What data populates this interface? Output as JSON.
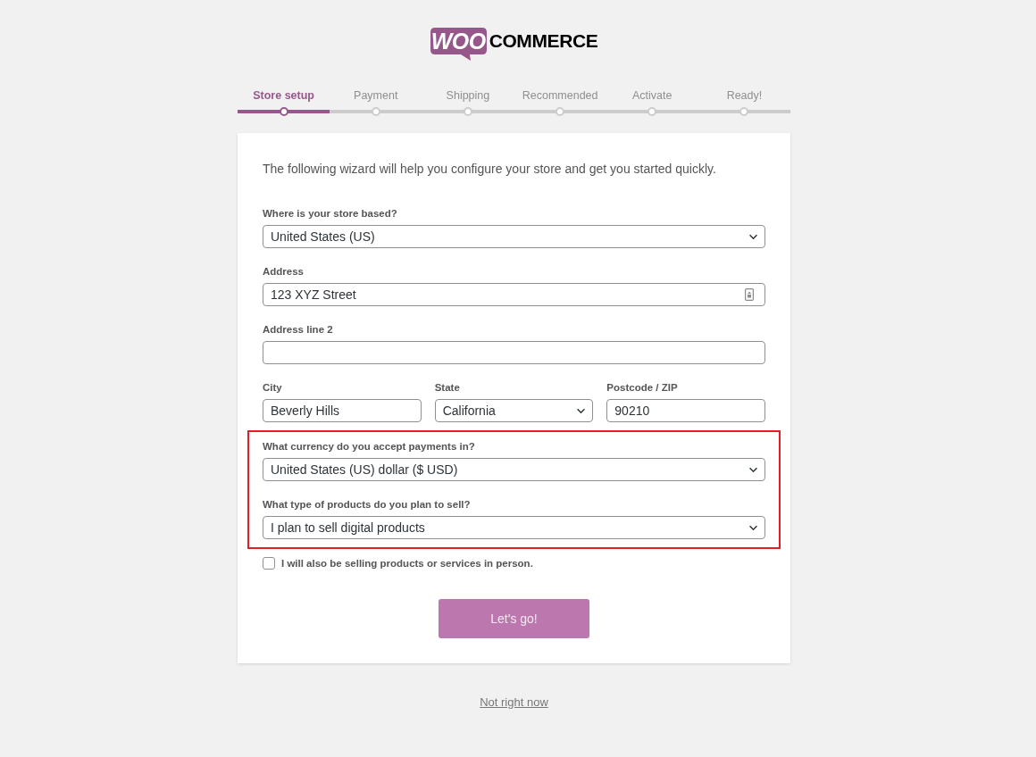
{
  "logo": {
    "badge": "WOO",
    "wordmark": "COMMERCE"
  },
  "steps": [
    {
      "label": "Store setup",
      "selected": true
    },
    {
      "label": "Payment",
      "selected": false
    },
    {
      "label": "Shipping",
      "selected": false
    },
    {
      "label": "Recommended",
      "selected": false
    },
    {
      "label": "Activate",
      "selected": false
    },
    {
      "label": "Ready!",
      "selected": false
    }
  ],
  "intro": "The following wizard will help you configure your store and get you started quickly.",
  "groups": [
    {
      "highlighted": false,
      "rows": [
        {
          "fields": [
            {
              "kind": "select",
              "label": "Where is your store based?",
              "value": "United States (US)"
            }
          ]
        },
        {
          "fields": [
            {
              "kind": "text",
              "label": "Address",
              "value": "123 XYZ Street",
              "autofill": true
            }
          ]
        },
        {
          "fields": [
            {
              "kind": "text",
              "label": "Address line 2",
              "autofill": false
            }
          ]
        },
        {
          "fields": [
            {
              "kind": "text",
              "label": "City",
              "value": "Beverly Hills",
              "autofill": false
            },
            {
              "kind": "select",
              "label": "State",
              "value": "California"
            },
            {
              "kind": "text",
              "label": "Postcode / ZIP",
              "value": "90210",
              "autofill": false
            }
          ]
        }
      ]
    },
    {
      "highlighted": true,
      "rows": [
        {
          "fields": [
            {
              "kind": "select",
              "label": "What currency do you accept payments in?",
              "value": "United States (US) dollar ($ USD)"
            }
          ]
        },
        {
          "fields": [
            {
              "kind": "select",
              "label": "What type of products do you plan to sell?",
              "value": "I plan to sell digital products"
            }
          ]
        }
      ]
    }
  ],
  "in_person": {
    "label": "I will also be selling products or services in person.",
    "checked": false
  },
  "submit_button": {
    "label": "Let's go!"
  },
  "skip_link": {
    "label": "Not right now"
  }
}
